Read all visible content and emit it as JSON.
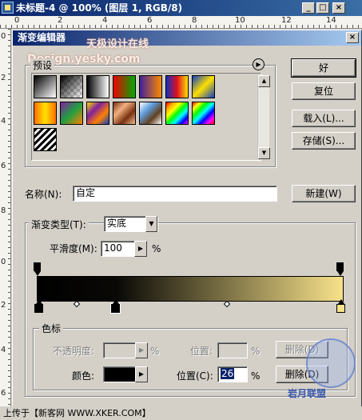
{
  "document_window": {
    "title": "未标题-4 @ 100% (图层 1, RGB/8)",
    "buttons": {
      "minimize": "_",
      "maximize": "□",
      "close": "×"
    },
    "ruler_top_labels": [
      "0",
      "2",
      "4",
      "6",
      "8",
      "10",
      "12",
      "14"
    ],
    "ruler_left_labels": [
      "0",
      "2",
      "4",
      "6",
      "8",
      "0",
      "2",
      "4",
      "6",
      "8"
    ]
  },
  "dialog": {
    "title": "渐变编辑器",
    "close_label": "×",
    "watermark_lines": [
      "天极设计在线",
      "Design.yesky.com"
    ],
    "presets": {
      "legend": "预设",
      "menu_icon": "right-arrow-circle-icon",
      "swatches": [
        {
          "name": "foreground-to-background",
          "css": "linear-gradient(135deg,#000 0%,#fff 100%)"
        },
        {
          "name": "foreground-to-transparent",
          "css": "linear-gradient(135deg,#000 0%,rgba(0,0,0,0) 100%)"
        },
        {
          "name": "black-white",
          "css": "linear-gradient(90deg,#000,#fff)"
        },
        {
          "name": "red-green",
          "css": "linear-gradient(90deg,#e00,#0a0)"
        },
        {
          "name": "violet-orange",
          "css": "linear-gradient(90deg,#40209a,#ff8a00)"
        },
        {
          "name": "blue-red-yellow",
          "css": "linear-gradient(90deg,#1030c0,#e01020,#ffe000)"
        },
        {
          "name": "blue-yellow-blue",
          "css": "linear-gradient(135deg,#1040c0,#ffe000,#1040c0)"
        },
        {
          "name": "orange-yellow-orange",
          "css": "linear-gradient(90deg,#ff7000,#ffe000,#ff7000)"
        },
        {
          "name": "violet-green-orange",
          "css": "linear-gradient(135deg,#8020a0,#20a040,#ff8000)"
        },
        {
          "name": "yellow-violet-orange-blue",
          "css": "linear-gradient(135deg,#ffe000,#8020a0,#ff8000,#1040c0)"
        },
        {
          "name": "copper",
          "css": "linear-gradient(135deg,#7a3010,#f0b080,#7a3010,#f0c090)"
        },
        {
          "name": "chrome",
          "css": "linear-gradient(135deg,#fff,#60a0e0,#604020,#fff)"
        },
        {
          "name": "spectrum",
          "css": "linear-gradient(135deg,red,orange,yellow,lime,cyan,blue,magenta)"
        },
        {
          "name": "transparent-rainbow",
          "css": "linear-gradient(135deg,red,yellow,lime,cyan,blue,magenta,red)"
        },
        {
          "name": "transparent-stripes",
          "css": "repeating-linear-gradient(135deg,#000 0 3px,#fff 3px 6px)"
        }
      ]
    },
    "buttons": {
      "ok": "好",
      "reset": "复位",
      "load": "载入(L)...",
      "save": "存储(S)...",
      "new": "新建(W)",
      "delete_opacity": "删除(D)",
      "delete_color": "删除(D)"
    },
    "name_label": "名称(N):",
    "name_value": "自定",
    "gradient_type_label": "渐变类型(T):",
    "gradient_type_value": "实底",
    "smoothness_label": "平滑度(M):",
    "smoothness_value": "100",
    "percent": "%",
    "stops_legend": "色标",
    "opacity_label": "不透明度:",
    "opacity_value": "",
    "opacity_location_label": "位置:",
    "opacity_location_value": "",
    "color_label": "颜色:",
    "color_location_label": "位置(C):",
    "color_location_value": "26",
    "colors": {
      "gradient_start": "#000000",
      "gradient_mid": "#0a0906",
      "gradient_end": "#f7e28a",
      "selected_color": "#000000",
      "accent": "#0a246a"
    }
  },
  "caption": "上传于【新客网 WWW.XKER.COM】",
  "watermark_logo": {
    "text": "岩月联盟"
  }
}
